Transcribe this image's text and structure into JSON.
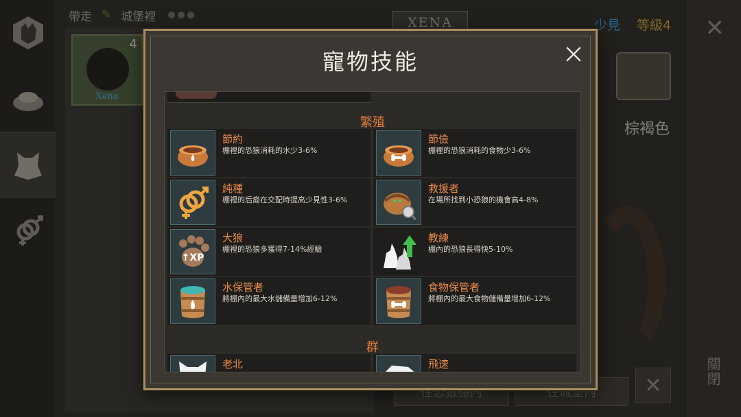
{
  "background": {
    "tabs": {
      "take": "帶走",
      "castle": "城堡裡"
    },
    "pet": {
      "name": "Xena",
      "count": "4"
    },
    "name_plate": "XENA",
    "rarity": "少見",
    "level": "等級4",
    "color": "棕褐色",
    "btn_to_den": "往恐狼棚內",
    "btn_to_castle": "往城堡內",
    "close_side_label": "關閉"
  },
  "modal": {
    "title": "寵物技能",
    "sections": [
      {
        "title": "繁殖",
        "skills": [
          {
            "name": "節約",
            "desc": "棚裡的恐狼消耗的水少3-6%",
            "icon": "water-bowl-icon"
          },
          {
            "name": "節儉",
            "desc": "棚裡的恐狼消耗的食物少3-6%",
            "icon": "food-bowl-icon"
          },
          {
            "name": "純種",
            "desc": "棚裡的后裔在交配時提高少見性3-6%",
            "icon": "gender-icon"
          },
          {
            "name": "救援者",
            "desc": "在場所找到小恐狼的機會高4-8%",
            "icon": "basket-search-icon"
          },
          {
            "name": "大狼",
            "desc": "棚裡的恐狼多獲得7-14%經驗",
            "icon": "paw-xp-icon"
          },
          {
            "name": "教練",
            "desc": "棚內的恐狼長得快5-10%",
            "icon": "wolf-growth-icon"
          },
          {
            "name": "水保管者",
            "desc": "將棚內的最大水儲備量增加6-12%",
            "icon": "water-barrel-icon"
          },
          {
            "name": "食物保管者",
            "desc": "將棚內的最大食物儲備量增加6-12%",
            "icon": "food-barrel-icon"
          }
        ]
      },
      {
        "title": "群",
        "skills": [
          {
            "name": "老北",
            "desc": "",
            "icon": "wolf-head-icon"
          },
          {
            "name": "飛速",
            "desc": "",
            "icon": "wolf-run-icon"
          }
        ]
      }
    ]
  },
  "colors": {
    "frame": "#a88d5c",
    "skill_name": "#e88a4a",
    "section": "#e07a3a",
    "rarity": "#3e8ec9",
    "level": "#c29a3a"
  }
}
